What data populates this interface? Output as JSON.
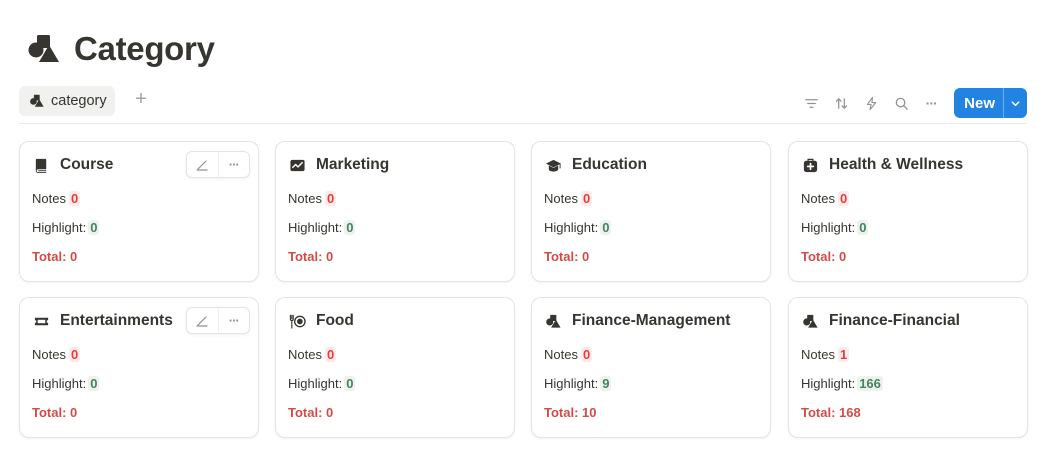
{
  "page": {
    "title": "Category",
    "icon": "shapes-icon"
  },
  "view": {
    "tab_label": "category",
    "tab_icon": "shapes-icon",
    "add_icon": "plus-icon",
    "add_label": "+"
  },
  "toolbar": {
    "icons": [
      "filter-icon",
      "sort-icon",
      "automation-icon",
      "search-icon",
      "more-icon"
    ],
    "more_label": "···",
    "new_label": "New",
    "new_dropdown_icon": "chevron-down-icon"
  },
  "labels": {
    "notes": "Notes",
    "highlight": "Highlight:",
    "total_prefix": "Total:",
    "card_more": "···"
  },
  "cards": [
    {
      "title": "Course",
      "icon": "book-icon",
      "notes": "0",
      "highlight": "0",
      "total": "0",
      "hover": true
    },
    {
      "title": "Marketing",
      "icon": "trend-chart-icon",
      "notes": "0",
      "highlight": "0",
      "total": "0",
      "hover": false
    },
    {
      "title": "Education",
      "icon": "graduation-cap-icon",
      "notes": "0",
      "highlight": "0",
      "total": "0",
      "hover": false
    },
    {
      "title": "Health & Wellness",
      "icon": "first-aid-kit-icon",
      "notes": "0",
      "highlight": "0",
      "total": "0",
      "hover": false
    },
    {
      "title": "Entertainments",
      "icon": "ticket-icon",
      "notes": "0",
      "highlight": "0",
      "total": "0",
      "hover": true
    },
    {
      "title": "Food",
      "icon": "utensils-plate-icon",
      "notes": "0",
      "highlight": "0",
      "total": "0",
      "hover": false
    },
    {
      "title": "Finance-Management",
      "icon": "shapes-icon",
      "notes": "0",
      "highlight": "9",
      "total": "10",
      "hover": false
    },
    {
      "title": "Finance-Financial",
      "icon": "shapes-icon",
      "notes": "1",
      "highlight": "166",
      "total": "168",
      "hover": false
    }
  ],
  "colors": {
    "accent": "#2383e2",
    "notes_red": "#e03e3e",
    "highlight_green": "#448361",
    "total_red": "#d44c47"
  }
}
